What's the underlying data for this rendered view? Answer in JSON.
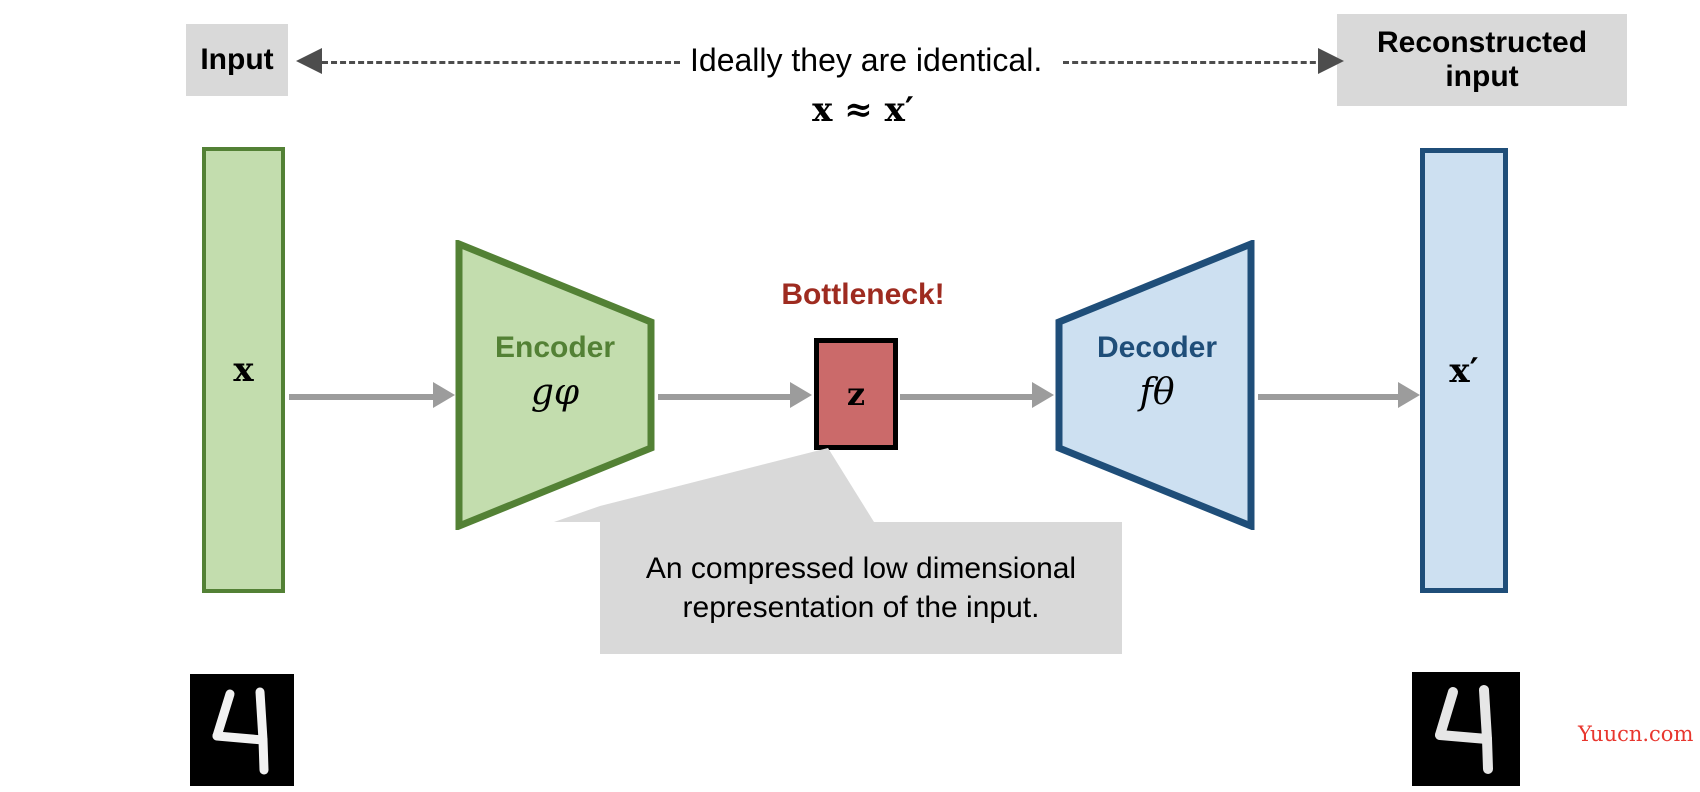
{
  "diagram": {
    "title_top_left": "Input",
    "title_top_right": "Reconstructed\ninput",
    "caption": "Ideally they are identical.",
    "equation": "x ≈ x′",
    "bottleneck_title": "Bottleneck!",
    "callout_text": "An compressed low dimensional representation of the input.",
    "watermark": "Yuucn.com"
  },
  "blocks": {
    "input_bar_label": "x",
    "output_bar_label": "x′",
    "encoder_title": "Encoder",
    "encoder_subscript": "gφ",
    "decoder_title": "Decoder",
    "decoder_subscript": "fθ",
    "latent_label": "z"
  },
  "labels": {
    "input_box": "Input",
    "reconstructed_line1": "Reconstructed",
    "reconstructed_line2": "input"
  },
  "colors": {
    "encoder_fill": "#c3ddae",
    "encoder_stroke": "#538135",
    "decoder_fill": "#cde0f1",
    "decoder_stroke": "#1f4e79",
    "bottleneck_fill": "#cb6a6a",
    "bottleneck_stroke": "#000000",
    "bottleneck_text": "#9e2b20",
    "callout_fill": "#d9d9d9",
    "label_box_fill": "#d9d9d9",
    "arrow_gray": "#9c9c9c",
    "dashed_gray": "#4d4d4d",
    "watermark_red": "#e8362e"
  },
  "icons": {
    "input_digit": "mnist-digit-four",
    "output_digit": "mnist-digit-four"
  }
}
